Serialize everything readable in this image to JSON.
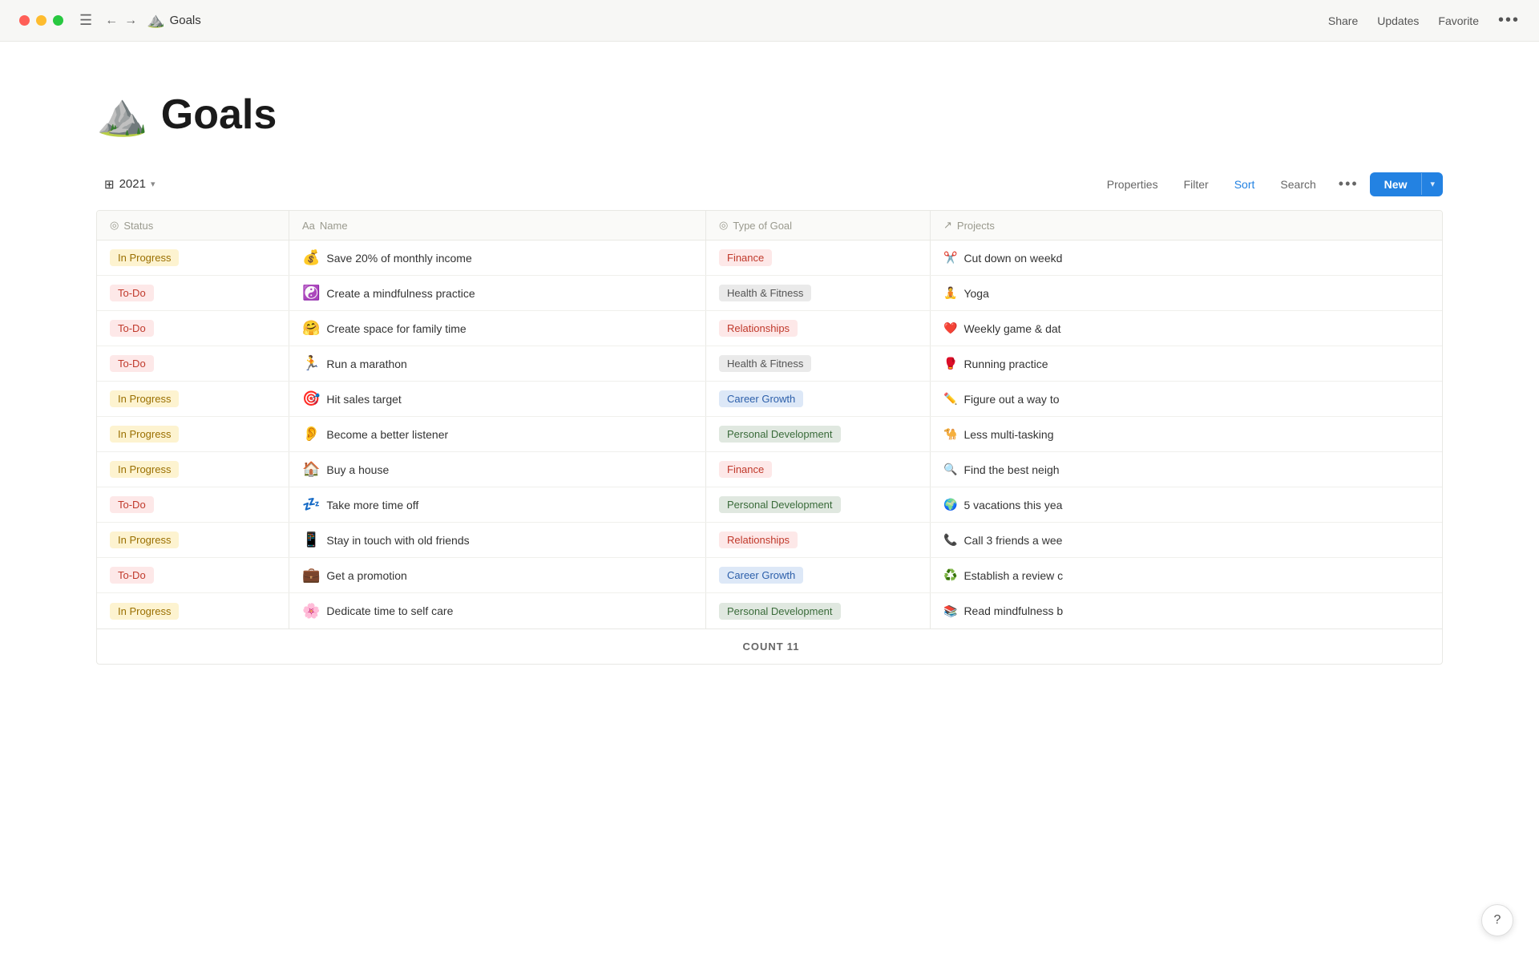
{
  "titlebar": {
    "page_icon": "⛰️",
    "page_title": "Goals",
    "nav_back": "←",
    "nav_forward": "→",
    "hamburger": "☰",
    "share": "Share",
    "updates": "Updates",
    "favorite": "Favorite",
    "more": "•••"
  },
  "page": {
    "icon": "⛰️",
    "title": "Goals"
  },
  "toolbar": {
    "view_icon": "⊞",
    "view_name": "2021",
    "properties": "Properties",
    "filter": "Filter",
    "sort": "Sort",
    "search": "Search",
    "more": "•••",
    "new_label": "New",
    "dropdown_arrow": "▾"
  },
  "table": {
    "columns": [
      {
        "icon": "◎",
        "label": "Status"
      },
      {
        "icon": "Aa",
        "label": "Name"
      },
      {
        "icon": "◎",
        "label": "Type of Goal"
      },
      {
        "icon": "↗",
        "label": "Projects"
      }
    ],
    "rows": [
      {
        "status": "In Progress",
        "status_type": "in-progress",
        "icon": "💰",
        "name": "Save 20% of monthly income",
        "goal_type": "Finance",
        "goal_badge": "finance",
        "project_icon": "✂️",
        "project": "Cut down on weekd"
      },
      {
        "status": "To-Do",
        "status_type": "to-do",
        "icon": "☯️",
        "name": "Create a mindfulness practice",
        "goal_type": "Health & Fitness",
        "goal_badge": "health",
        "project_icon": "🧘",
        "project": "Yoga"
      },
      {
        "status": "To-Do",
        "status_type": "to-do",
        "icon": "🤗",
        "name": "Create space for family time",
        "goal_type": "Relationships",
        "goal_badge": "relationships",
        "project_icon": "❤️",
        "project": "Weekly game & dat"
      },
      {
        "status": "To-Do",
        "status_type": "to-do",
        "icon": "🏃",
        "name": "Run a marathon",
        "goal_type": "Health & Fitness",
        "goal_badge": "health",
        "project_icon": "🥊",
        "project": "Running practice"
      },
      {
        "status": "In Progress",
        "status_type": "in-progress",
        "icon": "🎯",
        "name": "Hit sales target",
        "goal_type": "Career Growth",
        "goal_badge": "career",
        "project_icon": "✏️",
        "project": "Figure out a way to"
      },
      {
        "status": "In Progress",
        "status_type": "in-progress",
        "icon": "👂",
        "name": "Become a better listener",
        "goal_type": "Personal Development",
        "goal_badge": "personal",
        "project_icon": "🐪",
        "project": "Less multi-tasking"
      },
      {
        "status": "In Progress",
        "status_type": "in-progress",
        "icon": "🏠",
        "name": "Buy a house",
        "goal_type": "Finance",
        "goal_badge": "finance",
        "project_icon": "🔍",
        "project": "Find the best neigh"
      },
      {
        "status": "To-Do",
        "status_type": "to-do",
        "icon": "💤",
        "name": "Take more time off",
        "goal_type": "Personal Development",
        "goal_badge": "personal",
        "project_icon": "🌍",
        "project": "5 vacations this yea"
      },
      {
        "status": "In Progress",
        "status_type": "in-progress",
        "icon": "📱",
        "name": "Stay in touch with old friends",
        "goal_type": "Relationships",
        "goal_badge": "relationships",
        "project_icon": "📞",
        "project": "Call 3 friends a wee"
      },
      {
        "status": "To-Do",
        "status_type": "to-do",
        "icon": "💼",
        "name": "Get a promotion",
        "goal_type": "Career Growth",
        "goal_badge": "career",
        "project_icon": "♻️",
        "project": "Establish a review c"
      },
      {
        "status": "In Progress",
        "status_type": "in-progress",
        "icon": "🌸",
        "name": "Dedicate time to self care",
        "goal_type": "Personal Development",
        "goal_badge": "personal",
        "project_icon": "📚",
        "project": "Read mindfulness b"
      }
    ],
    "count_label": "COUNT",
    "count": "11"
  },
  "help": "?"
}
